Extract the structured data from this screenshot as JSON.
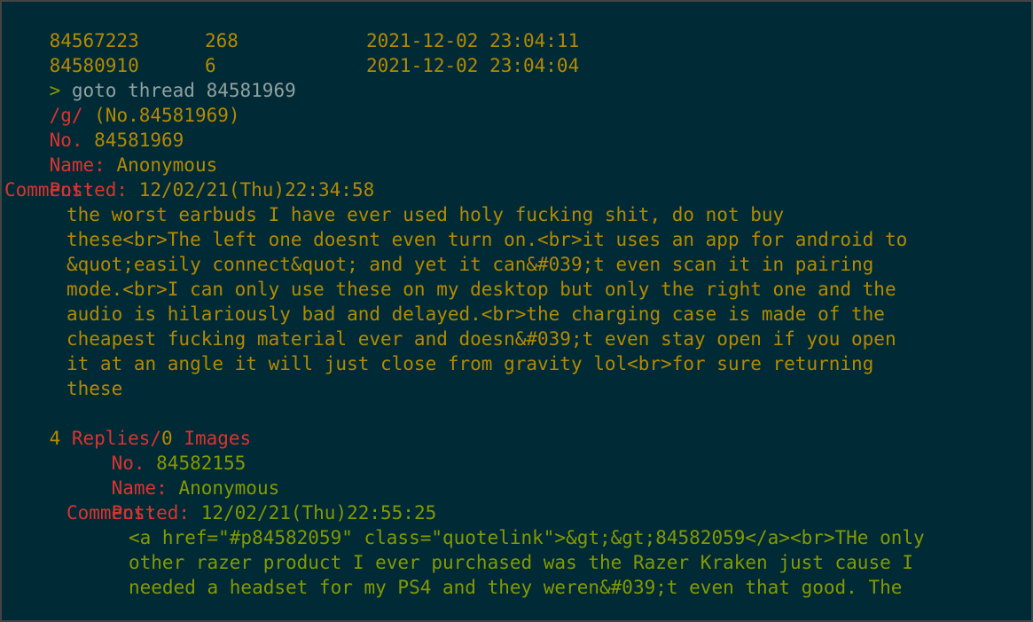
{
  "thread_list": [
    {
      "id": "84567223",
      "replies": "268",
      "time": "2021-12-02 23:04:11"
    },
    {
      "id": "84580910",
      "replies": "6",
      "time": "2021-12-02 23:04:04"
    }
  ],
  "command": {
    "prompt": ">",
    "text": " goto thread 84581969"
  },
  "board_header": {
    "board": "/g/",
    "post_ref": " (No.84581969)"
  },
  "op": {
    "no_label": "No.",
    "no_value": " 84581969",
    "name_label": "Name:",
    "name_value": " Anonymous",
    "posted_label": "Posted:",
    "posted_value": " 12/02/21(Thu)22:34:58",
    "comment_label": "Comment:",
    "comment_lines": [
      "the worst earbuds I have ever used holy fucking shit, do not buy",
      "these<br>The left one doesnt even turn on.<br>it uses an app for android to",
      "&quot;easily connect&quot; and yet it can&#039;t even scan it in pairing",
      "mode.<br>I can only use these on my desktop but only the right one and the",
      "audio is hilariously bad and delayed.<br>the charging case is made of the",
      "cheapest fucking material ever and doesn&#039;t even stay open if you open",
      "it at an angle it will just close from gravity lol<br>for sure returning",
      "these"
    ]
  },
  "stats": {
    "replies_count": "4",
    "replies_label": " Replies/",
    "images_count": "0",
    "images_label": " Images"
  },
  "reply": {
    "no_label": "No.",
    "no_value": " 84582155",
    "name_label": "Name:",
    "name_value": " Anonymous",
    "posted_label": "Posted:",
    "posted_value": " 12/02/21(Thu)22:55:25",
    "comment_label": "Comment:",
    "comment_lines": [
      "<a href=\"#p84582059\" class=\"quotelink\">&gt;&gt;84582059</a><br>THe only",
      "other razer product I ever purchased was the Razer Kraken just cause I",
      "needed a headset for my PS4 and they weren&#039;t even that good. The"
    ]
  }
}
